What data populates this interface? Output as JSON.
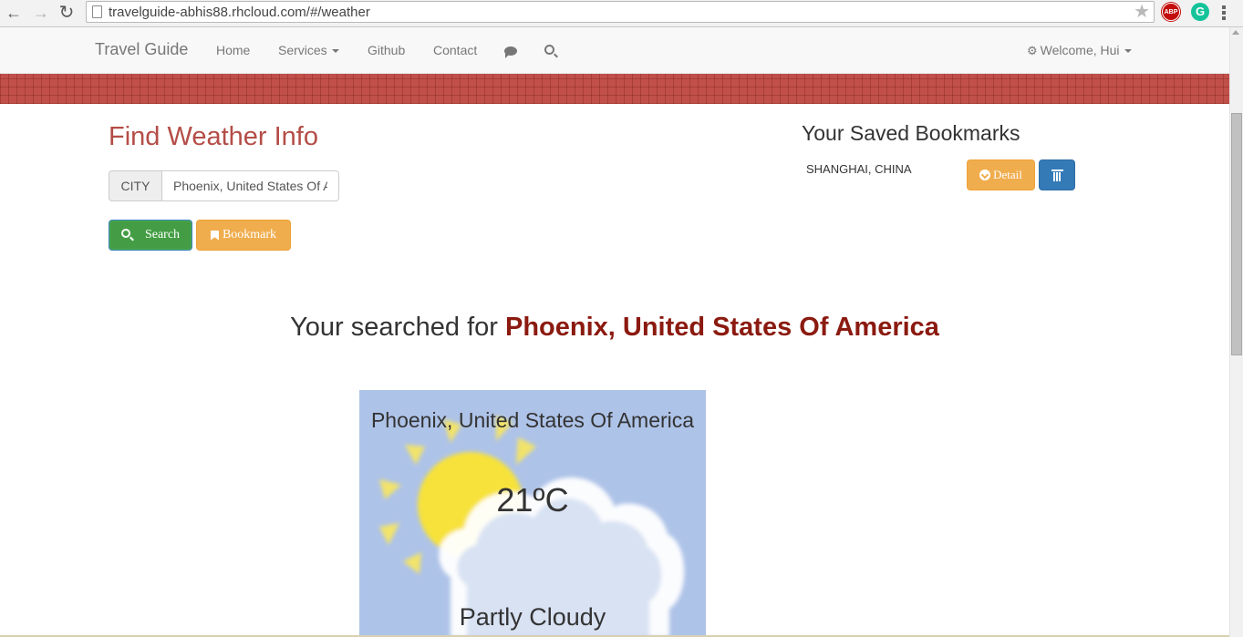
{
  "browser": {
    "url": "travelguide-abhis88.rhcloud.com/#/weather",
    "extensions": {
      "abp_label": "ABP",
      "grammarly_label": "G"
    }
  },
  "navbar": {
    "brand": "Travel Guide",
    "links": {
      "home": "Home",
      "services": "Services",
      "github": "Github",
      "contact": "Contact"
    },
    "welcome": "Welcome, Hui"
  },
  "weather_form": {
    "title": "Find Weather Info",
    "city_label": "CITY",
    "city_value": "Phoenix, United States Of America",
    "search_label": "Search",
    "bookmark_label": "Bookmark"
  },
  "bookmarks": {
    "title": "Your Saved Bookmarks",
    "items": [
      {
        "city": "SHANGHAI, CHINA",
        "detail_label": "Detail"
      }
    ]
  },
  "result": {
    "prefix": "Your searched for ",
    "city": "Phoenix, United States Of America"
  },
  "weather_card": {
    "city": "Phoenix, United States Of America",
    "temperature": "21ºC",
    "condition": "Partly Cloudy"
  },
  "colors": {
    "accent_red": "#b44d47",
    "result_city": "#8b1a10",
    "success": "#449d44",
    "warning": "#f0ad4e",
    "primary": "#337ab7",
    "card_bg": "#aec3e8"
  }
}
